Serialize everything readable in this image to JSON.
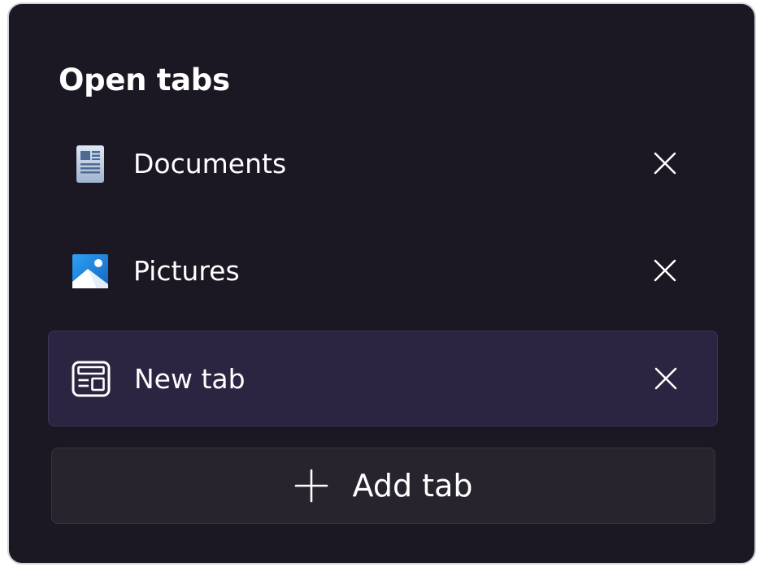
{
  "panel": {
    "title": "Open tabs"
  },
  "tabs": [
    {
      "label": "Documents",
      "icon": "documents-icon",
      "selected": false,
      "close_icon": "close-icon"
    },
    {
      "label": "Pictures",
      "icon": "pictures-icon",
      "selected": false,
      "close_icon": "close-icon"
    },
    {
      "label": "New tab",
      "icon": "new-tab-icon",
      "selected": true,
      "close_icon": "close-icon"
    }
  ],
  "add_button": {
    "label": "Add tab",
    "icon": "plus-icon"
  },
  "colors": {
    "panel_background": "#1b1723",
    "selected_tab_background": "#2c2541",
    "add_button_background": "#27242d",
    "text": "#ffffff",
    "pictures_accent": "#1e88e5"
  }
}
